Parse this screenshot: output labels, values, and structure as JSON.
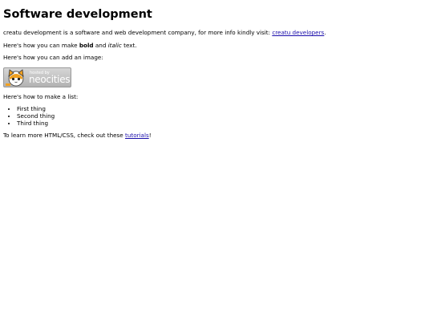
{
  "title": "Software development",
  "intro": {
    "text": "creatu development is a software and web development company, for more info kindly visit: ",
    "link_text": "creatu developers",
    "suffix": "."
  },
  "formatting": {
    "prefix": "Here's how you can make ",
    "bold": "bold",
    "middle": " and ",
    "italic": "italic",
    "suffix": " text."
  },
  "image_intro": "Here's how you can add an image:",
  "badge": {
    "hosted_text": "hosted by",
    "brand_text": "neocities",
    "icon": "neocities-cat-icon"
  },
  "list_intro": "Here's how to make a list:",
  "list_items": [
    "First thing",
    "Second thing",
    "Third thing"
  ],
  "outro": {
    "prefix": "To learn more HTML/CSS, check out these ",
    "link_text": "tutorials",
    "suffix": "!"
  },
  "colors": {
    "link": "#1a0dab",
    "text": "#000000"
  }
}
